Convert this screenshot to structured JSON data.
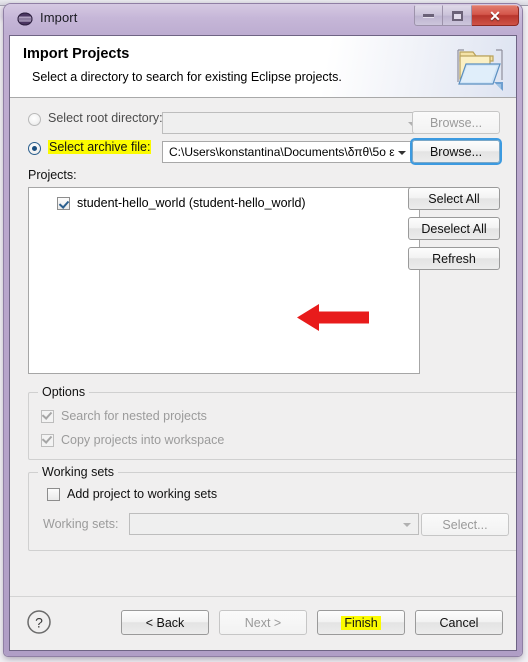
{
  "window": {
    "title": "Import",
    "icon": "eclipse-globe-icon",
    "controls": {
      "minimize": "minimize-icon",
      "maximize": "maximize-icon",
      "close": "✕"
    }
  },
  "header": {
    "title": "Import Projects",
    "subtitle": "Select a directory to search for existing Eclipse projects.",
    "icon": "open-folder-icon"
  },
  "source": {
    "root_directory": {
      "label": "Select root directory:",
      "selected": false,
      "value": "",
      "placeholder": "",
      "browse_label": "Browse...",
      "enabled": false
    },
    "archive_file": {
      "label": "Select archive file:",
      "selected": true,
      "highlighted": true,
      "value": "C:\\Users\\konstantina\\Documents\\δπθ\\5ο ε",
      "browse_label": "Browse...",
      "enabled": true
    }
  },
  "projects": {
    "label": "Projects:",
    "items": [
      {
        "label": "student-hello_world (student-hello_world)",
        "checked": true
      }
    ],
    "buttons": [
      {
        "label": "Select All",
        "enabled": true
      },
      {
        "label": "Deselect All",
        "enabled": true
      },
      {
        "label": "Refresh",
        "enabled": true
      }
    ],
    "annotation": "red-left-arrow"
  },
  "options": {
    "title": "Options",
    "checkboxes": [
      {
        "label": "Search for nested projects",
        "checked": true,
        "enabled": false
      },
      {
        "label": "Copy projects into workspace",
        "checked": true,
        "enabled": false
      }
    ]
  },
  "working_sets": {
    "title": "Working sets",
    "add_checkbox": {
      "label": "Add project to working sets",
      "checked": false,
      "enabled": true
    },
    "combo_label": "Working sets:",
    "combo_value": "",
    "select_label": "Select...",
    "enabled": false
  },
  "footer": {
    "help_label": "?",
    "buttons": [
      {
        "label": "< Back",
        "enabled": true,
        "highlighted": false
      },
      {
        "label": "Next >",
        "enabled": false,
        "highlighted": false
      },
      {
        "label": "Finish",
        "enabled": true,
        "highlighted": true
      },
      {
        "label": "Cancel",
        "enabled": true,
        "highlighted": false
      }
    ]
  },
  "colors": {
    "frame": "#b9a6cc",
    "highlight": "#fbfb00",
    "annotation": "#e81b1b",
    "close_button": "#c4443a",
    "focus_ring": "#3c9ae0"
  }
}
